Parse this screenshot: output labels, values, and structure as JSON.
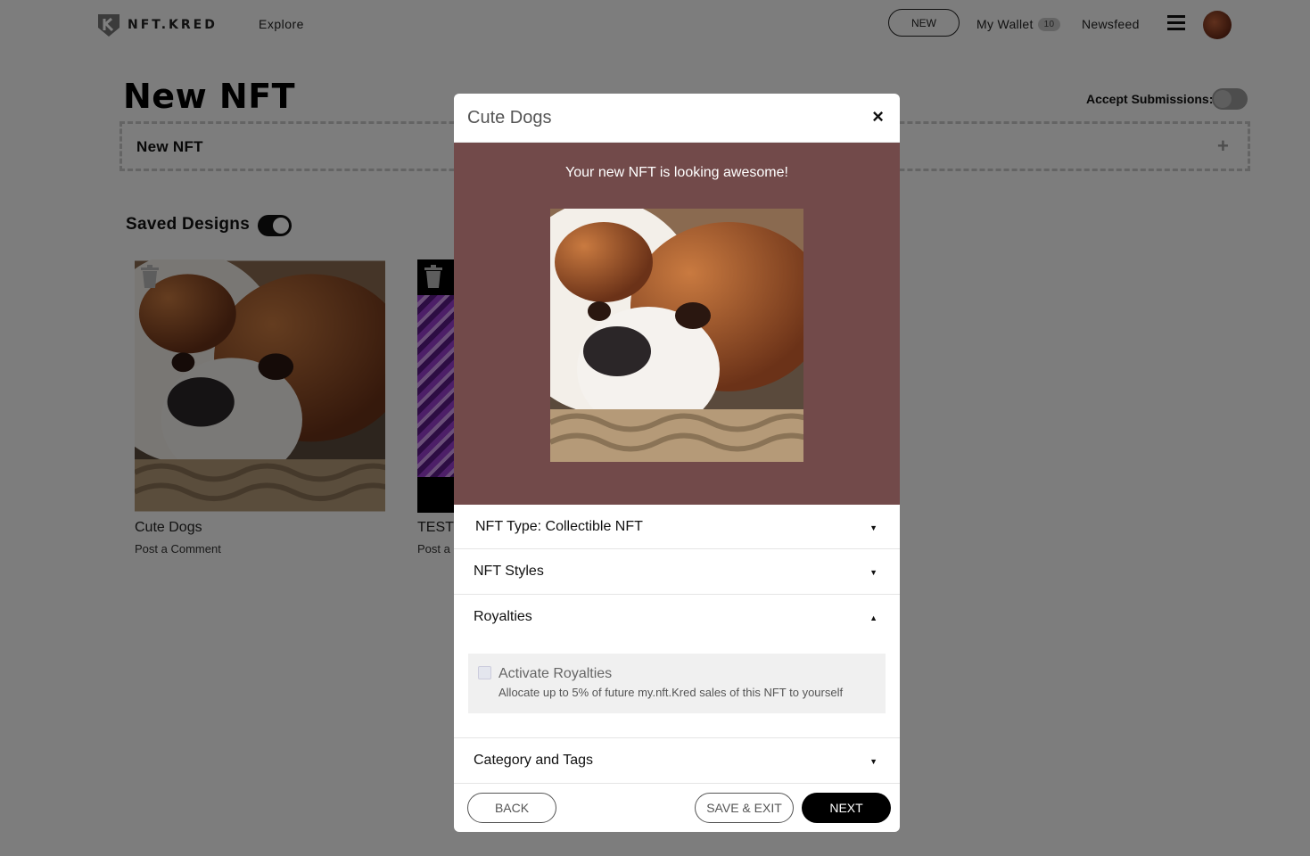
{
  "topbar": {
    "logo_text": "NFT.KRED",
    "explore": "Explore",
    "new_button": "NEW",
    "wallet_label": "My Wallet",
    "wallet_count": "10",
    "newsfeed": "Newsfeed"
  },
  "page": {
    "title": "New NFT",
    "accept_submissions_label": "Accept Submissions:",
    "collection_label": "New NFT",
    "add_glyph": "+",
    "saved_designs_label": "Saved Designs",
    "cards": [
      {
        "title": "Cute Dogs",
        "subtitle": "Post a Comment"
      },
      {
        "title": "TEST",
        "subtitle": "Post a"
      }
    ]
  },
  "modal": {
    "title": "Cute Dogs",
    "close_glyph": "×",
    "preview_message": "Your new NFT is looking awesome!",
    "sections": [
      {
        "label": "NFT Type: Collectible NFT",
        "arrow": "▼"
      },
      {
        "label": "NFT Styles",
        "arrow": "▼"
      },
      {
        "label": "Royalties",
        "arrow": "▲"
      },
      {
        "label": "Category and Tags",
        "arrow": "▼"
      }
    ],
    "royalties": {
      "checkbox_label": "Activate Royalties",
      "description": "Allocate up to 5% of future my.nft.Kred sales of this NFT to yourself",
      "checked": false
    },
    "buttons": {
      "back": "BACK",
      "save_exit": "SAVE & EXIT",
      "next": "NEXT"
    }
  },
  "colors": {
    "preview_bg": "#724a4a",
    "overlay": "rgba(0,0,0,0.5)",
    "primary_button": "#000000"
  }
}
